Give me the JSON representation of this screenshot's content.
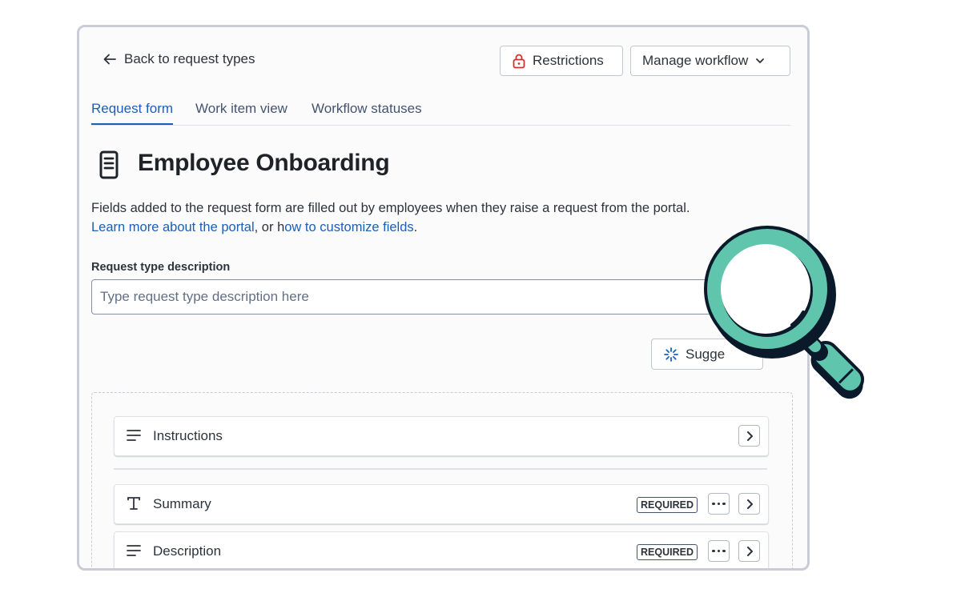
{
  "header": {
    "back_label": "Back to request types",
    "restrictions_label": "Restrictions",
    "manage_workflow_label": "Manage workflow"
  },
  "tabs": [
    {
      "label": "Request form",
      "active": true
    },
    {
      "label": "Work item view",
      "active": false
    },
    {
      "label": "Workflow statuses",
      "active": false
    }
  ],
  "page": {
    "title": "Employee Onboarding",
    "intro": "Fields added to the request form are filled out by employees when they raise a request from the portal.",
    "link_portal": "Learn more about the portal",
    "link_sep_1": ", or h",
    "link_fields": "ow to customize fields",
    "link_end": "."
  },
  "description_field": {
    "label": "Request type description",
    "placeholder": "Type request type description here"
  },
  "suggest_label": "Sugge",
  "fields": [
    {
      "label": "Instructions",
      "icon": "lines-icon",
      "required": false
    },
    {
      "label": "Summary",
      "icon": "text-t-icon",
      "required": true,
      "badge": "REQUIRED"
    },
    {
      "label": "Description",
      "icon": "lines-icon",
      "required": true,
      "badge": "REQUIRED"
    }
  ],
  "colors": {
    "accent": "#1d5fb5",
    "magnifier": "#5fc6ad",
    "restriction_icon": "#c9372c"
  }
}
